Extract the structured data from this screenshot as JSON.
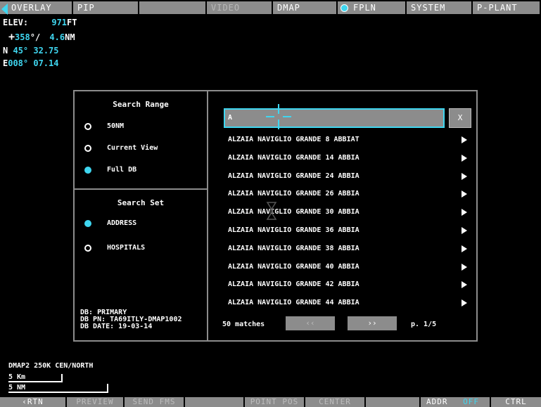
{
  "top_tabs": [
    {
      "label": "OVERLAY"
    },
    {
      "label": "PIP"
    },
    {
      "label": ""
    },
    {
      "label": "VIDEO"
    },
    {
      "label": "DMAP"
    },
    {
      "label": "FPLN"
    },
    {
      "label": "SYSTEM"
    },
    {
      "label": "P-PLANT"
    }
  ],
  "status": {
    "elev_label": "ELEV:",
    "elev_value": "971",
    "elev_unit": "FT",
    "bearing_symbol": "+",
    "bearing_value": "358",
    "bearing_sep": "°/",
    "distance_value": "4.6",
    "distance_unit": "NM",
    "lat_prefix": "N",
    "lat_value": "45° 32.75",
    "lon_prefix": "E",
    "lon_value": "008° 07.14"
  },
  "search_range": {
    "title": "Search Range",
    "options": [
      {
        "label": "50NM",
        "selected": false
      },
      {
        "label": "Current View",
        "selected": false
      },
      {
        "label": "Full DB",
        "selected": true
      }
    ]
  },
  "search_set": {
    "title": "Search Set",
    "options": [
      {
        "label": "ADDRESS",
        "selected": true
      },
      {
        "label": "HOSPITALS",
        "selected": false
      }
    ]
  },
  "db_info": {
    "line1": "DB: PRIMARY",
    "line2": "DB PN: TA69ITLY-DMAP1002",
    "line3": "DB DATE: 19-03-14"
  },
  "search": {
    "value": "A",
    "clear_label": "X"
  },
  "results": [
    "ALZAIA NAVIGLIO GRANDE 8 ABBIAT",
    "ALZAIA NAVIGLIO GRANDE 14 ABBIA",
    "ALZAIA NAVIGLIO GRANDE 24 ABBIA",
    "ALZAIA NAVIGLIO GRANDE 26 ABBIA",
    "ALZAIA NAVIGLIO GRANDE 30 ABBIA",
    "ALZAIA NAVIGLIO GRANDE 36 ABBIA",
    "ALZAIA NAVIGLIO GRANDE 38 ABBIA",
    "ALZAIA NAVIGLIO GRANDE 40 ABBIA",
    "ALZAIA NAVIGLIO GRANDE 42 ABBIA",
    "ALZAIA NAVIGLIO GRANDE 44 ABBIA"
  ],
  "pagination": {
    "matches": "50 matches",
    "prev_label": "‹‹",
    "next_label": "››",
    "page": "p. 1/5"
  },
  "map_info": {
    "line": "DMAP2  250K  CEN/NORTH",
    "scale_km": "5 Km",
    "scale_nm": "5 NM"
  },
  "bottom_tabs": [
    {
      "label": "‹RTN"
    },
    {
      "label": "PREVIEW"
    },
    {
      "label": "SEND FMS"
    },
    {
      "label": ""
    },
    {
      "label": "POINT POS"
    },
    {
      "label": "CENTER"
    },
    {
      "label": ""
    },
    {
      "label": "ADDR"
    },
    {
      "label": "OFF"
    },
    {
      "label": "CTRL"
    }
  ],
  "colors": {
    "accent": "#3fd6f0",
    "button_gray": "#8c8c8c",
    "background": "#000000"
  }
}
